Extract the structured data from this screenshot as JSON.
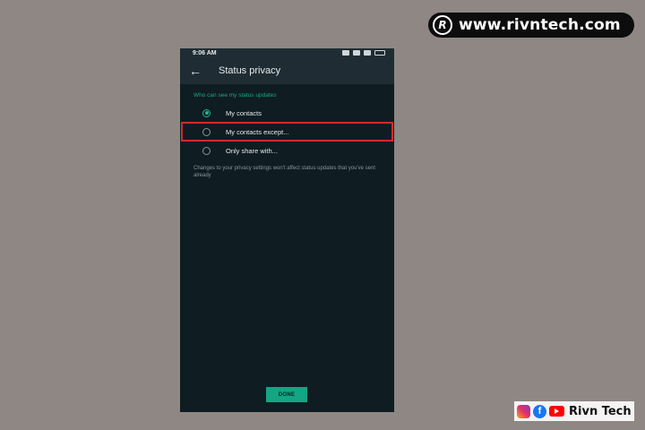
{
  "watermark": {
    "logo_letter": "R",
    "site": "www.rivntech.com"
  },
  "statusbar": {
    "time": "9:06 AM"
  },
  "appbar": {
    "back_icon": "arrow-left-icon",
    "title": "Status privacy"
  },
  "section": {
    "heading": "Who can see my status updates"
  },
  "options": [
    {
      "label": "My contacts",
      "selected": true
    },
    {
      "label": "My contacts except...",
      "selected": false
    },
    {
      "label": "Only share with...",
      "selected": false
    }
  ],
  "note": "Changes to your privacy settings won't affect status updates that you've sent already",
  "done_label": "DONE",
  "social": {
    "fb_letter": "f",
    "brand": "Rivn Tech"
  },
  "colors": {
    "accent": "#17a884",
    "highlight_box": "#d32a2a",
    "background": "#0f1c22"
  }
}
